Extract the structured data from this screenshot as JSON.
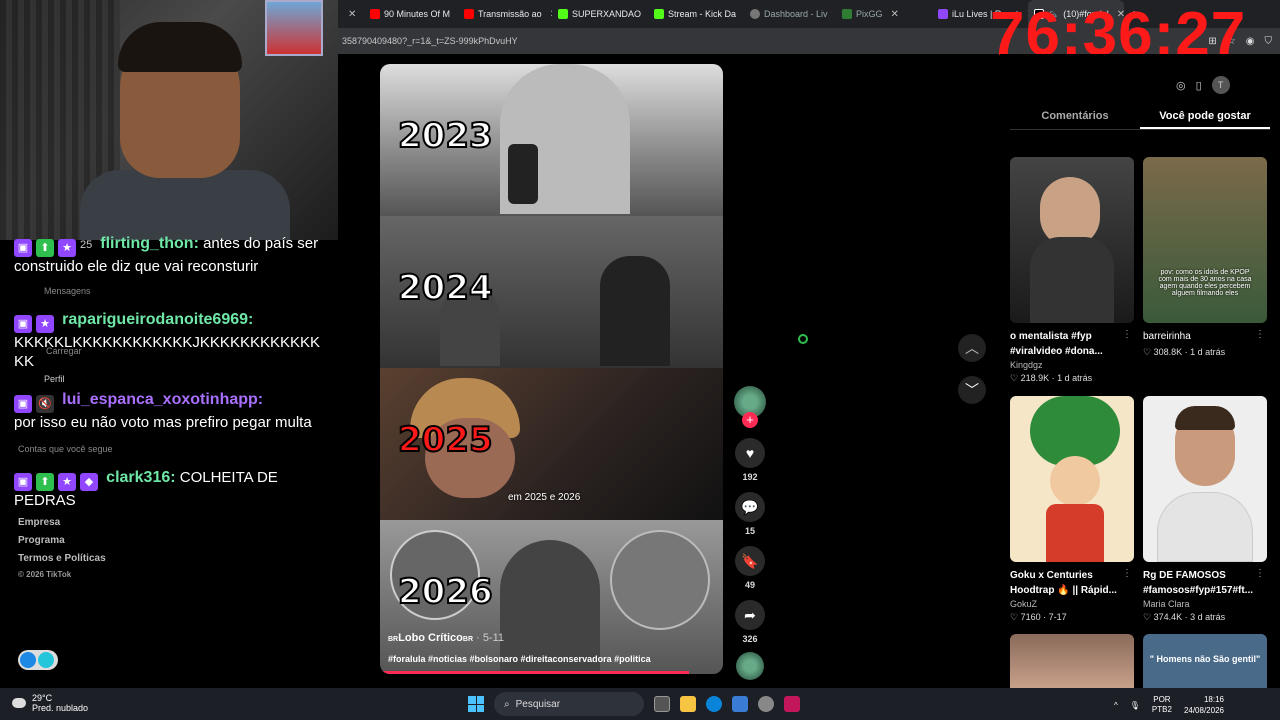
{
  "browser": {
    "tabs": [
      {
        "label": "",
        "color": "#888"
      },
      {
        "label": "90 Minutes Of M",
        "color": "#ff0000"
      },
      {
        "label": "Transmissão ao",
        "color": "#ff0000"
      },
      {
        "label": "SUPERXANDAO",
        "color": "#53fc18"
      },
      {
        "label": "Stream - Kick Da",
        "color": "#53fc18"
      },
      {
        "label": "Dashboard - Liv",
        "color": "#777777"
      },
      {
        "label": "PixGG",
        "color": "#2e7d32"
      },
      {
        "label": "iLu Lives | React",
        "color": "#9146ff"
      },
      {
        "label": "(10)#foralul",
        "color": "#ffffff"
      }
    ],
    "url": "358790409480?_r=1&_t=ZS-999kPhDvuHY",
    "new_tab": "+"
  },
  "timer": "76:36:27",
  "chat": {
    "messages": [
      {
        "user": "flirting_thon:",
        "text": "antes do país ser construido ele diz que vai reconsturir",
        "user_color": "#6ee7a7"
      },
      {
        "user": "raparigueirodanoite6969:",
        "text": "KKKKKLKKKKKKKKKKKKJKKKKKKKKKKKKKK",
        "user_color": "#6ee7a7"
      },
      {
        "user": "lui_espanca_xoxotinhapp:",
        "text": "por isso eu não voto mas prefiro pegar multa",
        "user_color": "#a970ff"
      },
      {
        "user": "clark316:",
        "text": "COLHEITA DE PEDRAS",
        "user_color": "#6ee7a7"
      }
    ],
    "badge_count": "25"
  },
  "tiktok_sidebar": {
    "mensagens": "Mensagens",
    "carregar": "Carregar",
    "perfil": "Perfil",
    "contas": "Contas que você segue",
    "links": [
      "Empresa",
      "Programa",
      "Termos e Políticas"
    ],
    "copyright": "© 2026 TikTok"
  },
  "video": {
    "years": [
      "2023",
      "2024",
      "2025",
      "2026"
    ],
    "caption_2025": "em 2025 e 2026",
    "author": "Lobo Crítico",
    "author_prefix": "BR",
    "author_suffix": "BR",
    "date": "· 5-11",
    "hashtags": "#foralula #noticias #bolsonaro #direitaconservadora #politica"
  },
  "actions": {
    "likes": "192",
    "comments": "15",
    "saves": "49",
    "shares": "326"
  },
  "right_panel": {
    "tab_comments": "Comentários",
    "tab_suggested": "Você pode gostar",
    "avatar_letter": "T",
    "cards": [
      {
        "title": "o mentalista #fyp #viralvideo #dona...",
        "author": "Kingdgz",
        "likes": "218.9K",
        "time": "1 d atrás",
        "thumb_color": "#2b2b2b"
      },
      {
        "title": "barreirinha",
        "author": "",
        "likes": "308.8K",
        "time": "1 d atrás",
        "thumb_color": "#5a4a2e",
        "overlay": "pov: como os idols de KPOP com mais de 30 anos na casa agem quando eles percebem alguem filmando eles"
      },
      {
        "title": "Goku x Centuries Hoodtrap 🔥 || Rápid...",
        "author": "GokuZ",
        "likes": "7160",
        "time": "7-17",
        "thumb_color": "#f6e6c8"
      },
      {
        "title": "Rg DE FAMOSOS #famosos#fyp#157#ft...",
        "author": "Maria Clara",
        "likes": "374.4K",
        "time": "3 d atrás",
        "thumb_color": "#eeeeee"
      }
    ],
    "bottom_card_text": "\" Homens não São gentil\""
  },
  "taskbar": {
    "temp": "29°C",
    "weather": "Pred. nublado",
    "search": "Pesquisar",
    "lang1": "POR",
    "lang2": "PTB2",
    "time": "18:16",
    "date": "24/08/2026"
  }
}
